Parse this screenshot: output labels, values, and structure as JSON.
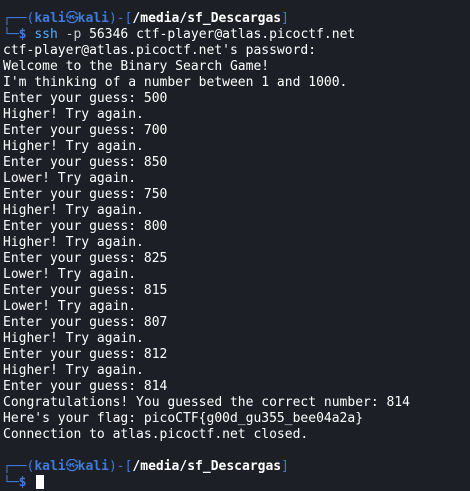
{
  "prompt": {
    "frame_top": "┌──(",
    "user": "kali",
    "host": "kali",
    "path_open": ")-[",
    "path": "/media/sf_Descargas",
    "path_close": "]",
    "frame_bottom": "└─",
    "dollar": "$"
  },
  "command": {
    "program": "ssh",
    "flag": "-p",
    "port": "56346",
    "target": "ctf-player@atlas.picoctf.net"
  },
  "output_lines": [
    "ctf-player@atlas.picoctf.net's password:",
    "Welcome to the Binary Search Game!",
    "I'm thinking of a number between 1 and 1000.",
    "Enter your guess: 500",
    "Higher! Try again.",
    "Enter your guess: 700",
    "Higher! Try again.",
    "Enter your guess: 850",
    "Lower! Try again.",
    "Enter your guess: 750",
    "Higher! Try again.",
    "Enter your guess: 800",
    "Higher! Try again.",
    "Enter your guess: 825",
    "Lower! Try again.",
    "Enter your guess: 815",
    "Lower! Try again.",
    "Enter your guess: 807",
    "Higher! Try again.",
    "Enter your guess: 812",
    "Higher! Try again.",
    "Enter your guess: 814",
    "Congratulations! You guessed the correct number: 814",
    "Here's your flag: picoCTF{g00d_gu355_bee04a2a}",
    "Connection to atlas.picoctf.net closed."
  ],
  "icons": {
    "at_symbol": "kali-dragon-icon"
  },
  "colors": {
    "background": "#1d1f26",
    "prompt_accent": "#3f7ad9",
    "command": "#4fb0ff",
    "text": "#ffffff"
  }
}
